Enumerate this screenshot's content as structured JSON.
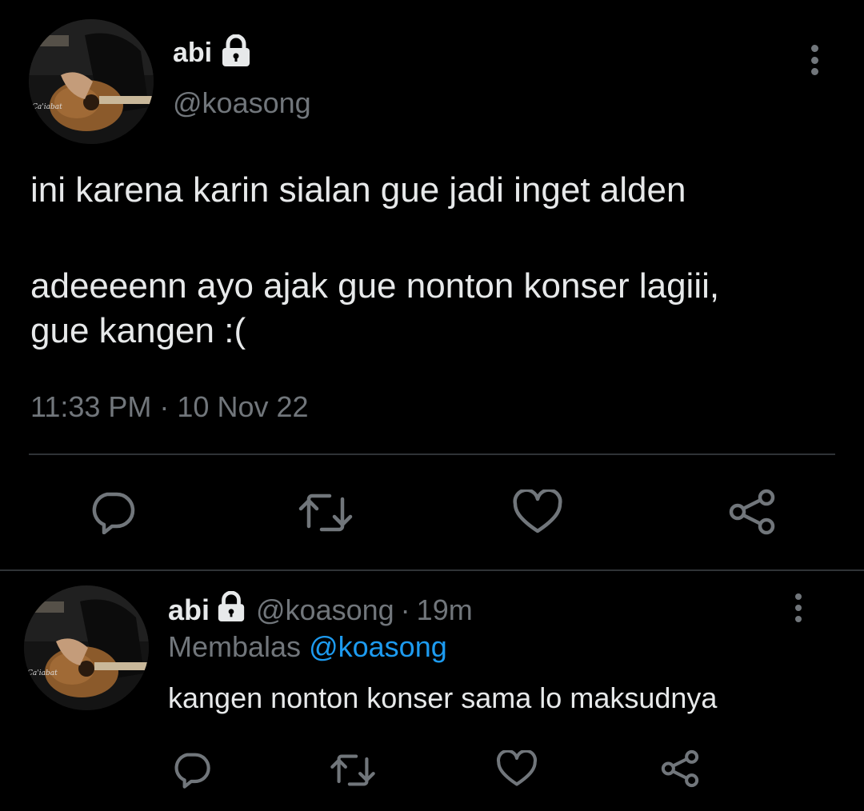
{
  "main_tweet": {
    "display_name": "abi",
    "handle": "@koasong",
    "text_line_1": "ini karena karin sialan gue jadi inget alden",
    "text_line_2": "adeeeenn ayo ajak gue nonton konser lagiii,",
    "text_line_3": "gue kangen :(",
    "timestamp": "11:33 PM · 10 Nov 22"
  },
  "reply_tweet": {
    "display_name": "abi",
    "handle": "@koasong",
    "separator": "·",
    "time_ago": "19m",
    "replying_prefix": "Membalas",
    "replying_to": "@koasong",
    "text": "kangen nonton konser sama lo maksudnya"
  },
  "icons": {
    "lock": "lock-icon",
    "more": "more-vertical-icon",
    "reply": "reply-icon",
    "retweet": "retweet-icon",
    "like": "heart-icon",
    "share": "share-icon"
  },
  "colors": {
    "background": "#000000",
    "text": "#e7e9ea",
    "muted": "#71767b",
    "link": "#1d9bf0",
    "divider": "#2f3336"
  }
}
